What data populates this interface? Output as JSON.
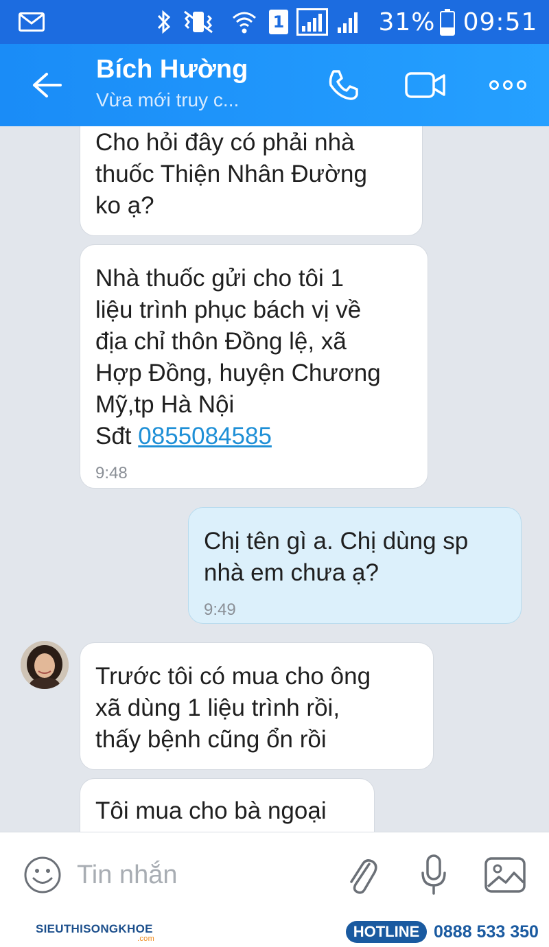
{
  "status_bar": {
    "battery_percent": "31%",
    "time": "09:51",
    "sim_indicator": "1",
    "icons": [
      "mail-icon",
      "bluetooth-icon",
      "vibrate-icon",
      "wifi-icon",
      "sim-icon",
      "signal-icon",
      "signal-icon",
      "battery-icon"
    ],
    "battery_level": 0.31
  },
  "header": {
    "contact_name": "Bích Hường",
    "contact_status": "Vừa mới truy c...",
    "icons": [
      "back-arrow-icon",
      "phone-icon",
      "video-call-icon",
      "more-icon"
    ]
  },
  "messages": [
    {
      "sender": "contact",
      "text": "Cho hỏi đây có phải nhà\nthuốc Thiện Nhân Đường\nko ạ?",
      "time": ""
    },
    {
      "sender": "contact",
      "text": "Nhà thuốc gửi cho tôi 1\nliệu trình phục bách vị về\nđịa chỉ thôn Đồng lệ, xã\nHợp Đồng, huyện Chương\nMỹ,tp Hà Nội\nSđt ",
      "phone": "0855084585",
      "time": "9:48"
    },
    {
      "sender": "me",
      "text": "Chị tên gì a. Chị dùng sp\nnhà em chưa ạ?",
      "time": "9:49"
    },
    {
      "sender": "contact",
      "text": "Trước tôi có mua cho ông\nxã dùng 1 liệu trình rồi,\nthấy bệnh cũng ổn rồi",
      "time": ""
    },
    {
      "sender": "contact",
      "text": "Tôi mua cho bà ngoại",
      "time": ""
    }
  ],
  "input_bar": {
    "placeholder": "Tin nhắn",
    "icons": [
      "emoji-icon",
      "attach-icon",
      "microphone-icon",
      "image-icon"
    ]
  },
  "watermark": {
    "logo_text": "SIEUTHISONGKHOE",
    "logo_domain": ".com",
    "hotline_label": "HOTLINE",
    "hotline_number": "0888 533 350"
  },
  "colors": {
    "status_bar": "#1c6ce0",
    "header": "#1a8cf7",
    "chat_background": "#e2e6ec",
    "my_bubble": "#dcf0fb",
    "link": "#1e8fd6",
    "hotline": "#1a5aa0"
  }
}
